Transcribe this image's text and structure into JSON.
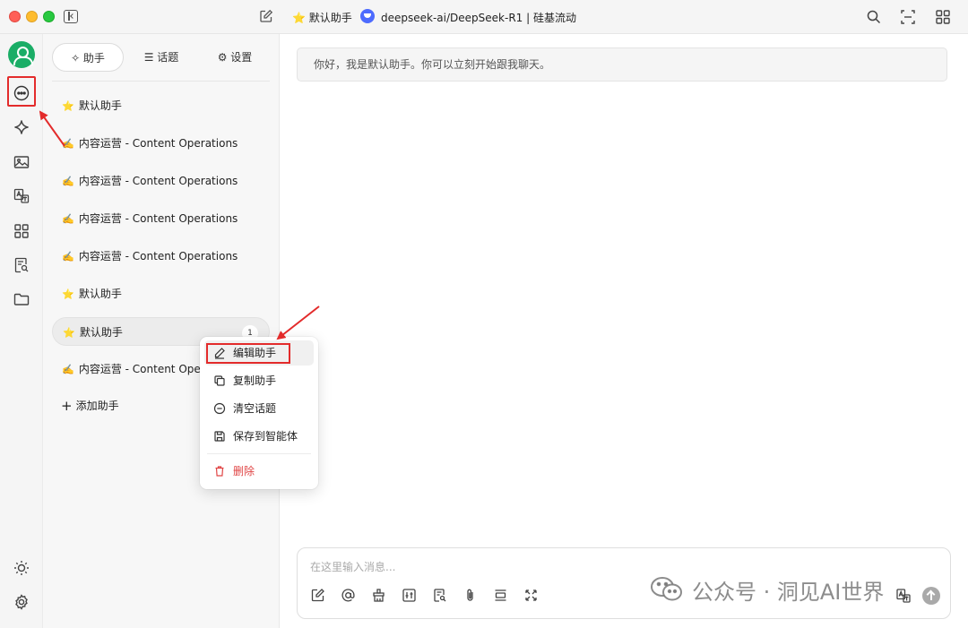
{
  "titlebar": {
    "assistant_title": "⭐ 默认助手",
    "model_title": "deepseek-ai/DeepSeek-R1 | 硅基流动"
  },
  "panel": {
    "tabs": [
      {
        "label": "✧ 助手"
      },
      {
        "label": "☰ 话题"
      },
      {
        "label": "⚙ 设置"
      }
    ],
    "items": [
      {
        "emoji": "⭐",
        "label": "默认助手"
      },
      {
        "emoji": "✍️",
        "label": "内容运营 - Content Operations"
      },
      {
        "emoji": "✍️",
        "label": "内容运营 - Content Operations"
      },
      {
        "emoji": "✍️",
        "label": "内容运营 - Content Operations"
      },
      {
        "emoji": "✍️",
        "label": "内容运营 - Content Operations"
      },
      {
        "emoji": "⭐",
        "label": "默认助手"
      },
      {
        "emoji": "⭐",
        "label": "默认助手",
        "badge": "1"
      },
      {
        "emoji": "✍️",
        "label": "内容运营 - Content Operations"
      }
    ],
    "add_label": "添加助手"
  },
  "context_menu": {
    "edit": "编辑助手",
    "copy": "复制助手",
    "clear": "清空话题",
    "save": "保存到智能体",
    "delete": "删除"
  },
  "chat": {
    "welcome": "你好，我是默认助手。你可以立刻开始跟我聊天。",
    "input_placeholder": "在这里输入消息..."
  },
  "watermark": {
    "text": "公众号 · 洞见AI世界"
  },
  "colors": {
    "accent_red": "#e32b2b",
    "avatar_green": "#1aad66",
    "delete_red": "#e04444"
  }
}
